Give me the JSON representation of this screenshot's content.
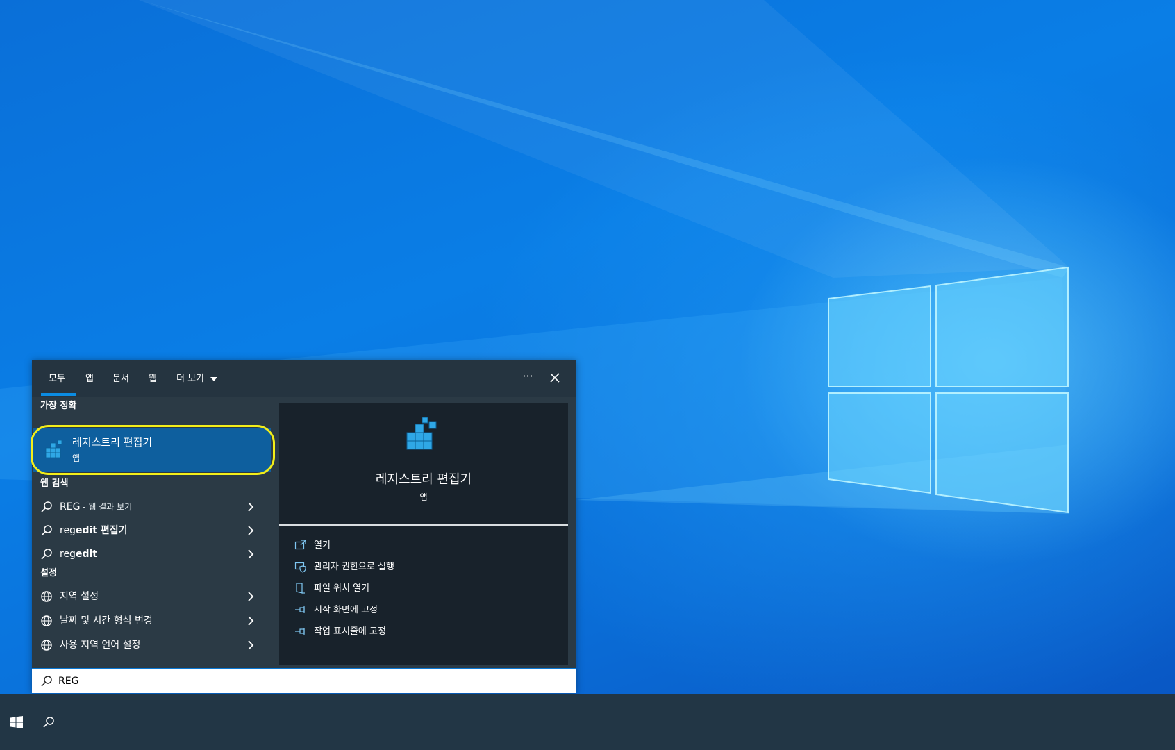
{
  "search_panel": {
    "tabs": [
      {
        "label": "모두"
      },
      {
        "label": "앱"
      },
      {
        "label": "문서"
      },
      {
        "label": "웹"
      },
      {
        "label": "더 보기"
      }
    ],
    "more_options": "···",
    "best_match_header": "가장 정확",
    "best_match": {
      "title": "레지스트리 편집기",
      "subtitle": "앱"
    },
    "web_search_header": "웹 검색",
    "web_results": [
      {
        "query": "REG",
        "suffix": " - 웹 결과 보기"
      },
      {
        "prefix": "reg",
        "bold": "edit",
        "rest": " 편집기"
      },
      {
        "prefix": "reg",
        "bold": "edit",
        "rest": ""
      }
    ],
    "settings_header": "설정",
    "settings_results": [
      {
        "label": "지역 설정"
      },
      {
        "label": "날짜 및 시간 형식 변경"
      },
      {
        "label": "사용 지역 언어 설정"
      }
    ],
    "detail": {
      "title": "레지스트리 편집기",
      "subtitle": "앱",
      "actions": [
        {
          "label": "열기",
          "icon": "open-icon"
        },
        {
          "label": "관리자 권한으로 실행",
          "icon": "shield-icon"
        },
        {
          "label": "파일 위치 열기",
          "icon": "file-location-icon"
        },
        {
          "label": "시작 화면에 고정",
          "icon": "pin-icon"
        },
        {
          "label": "작업 표시줄에 고정",
          "icon": "pin-icon"
        }
      ]
    },
    "search_value": "REG"
  },
  "colors": {
    "accent": "#0b8ce3",
    "highlight_ring": "#f3ee19",
    "selected_row": "#0e5f9e",
    "panel_bg": "#2b3a45",
    "detail_bg": "#18222b",
    "taskbar_bg": "#223645"
  }
}
